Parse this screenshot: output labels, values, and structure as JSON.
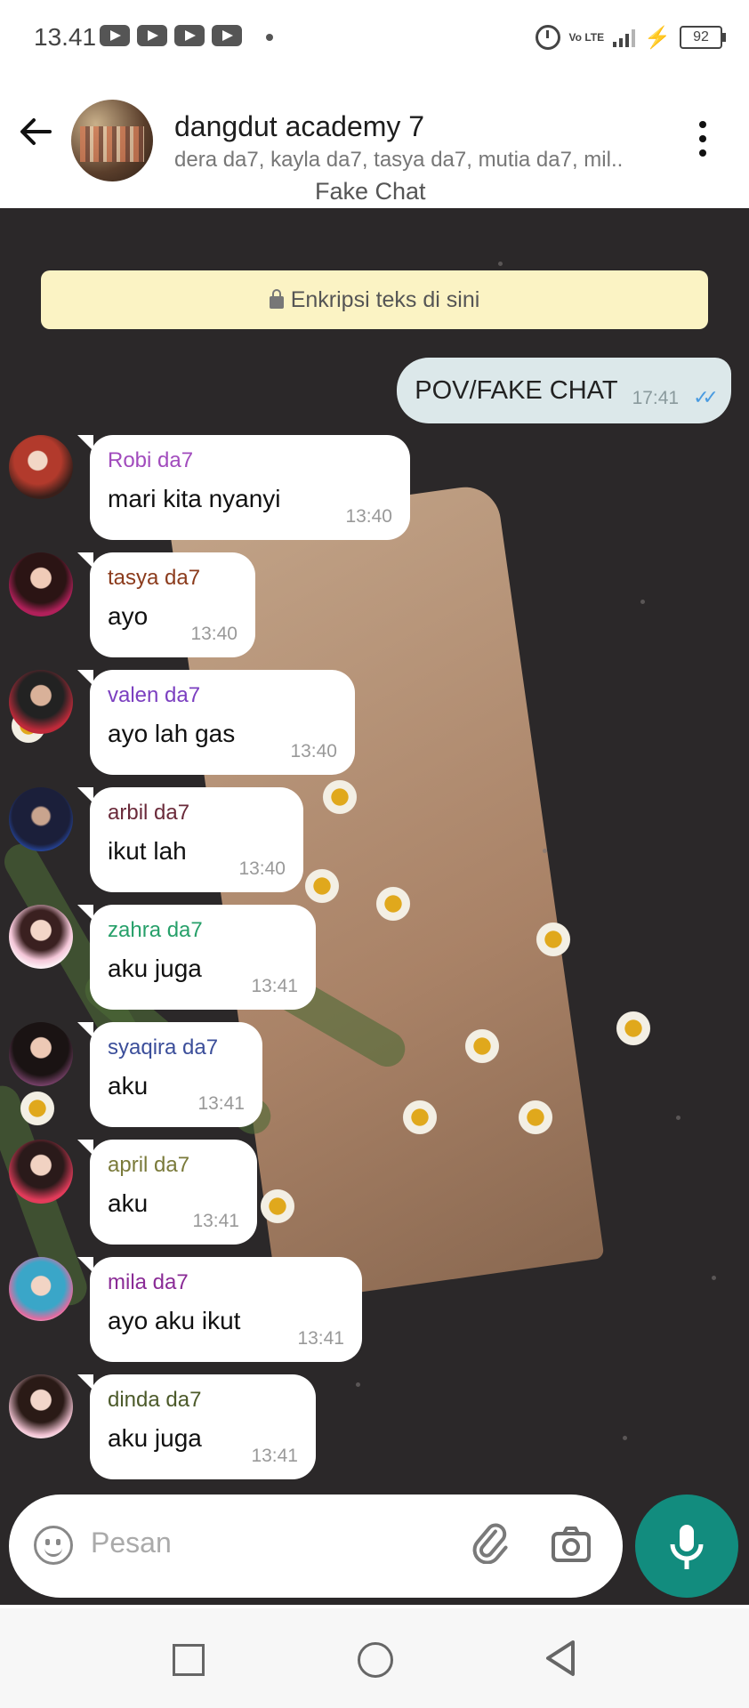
{
  "status_bar": {
    "time": "13.41",
    "volte": "Vo LTE",
    "battery": "92",
    "youtube_icons": 4
  },
  "header": {
    "title": "dangdut academy 7",
    "members": "dera da7, kayla da7, tasya da7, mutia da7, mil..",
    "subtitle": "Fake Chat"
  },
  "chat": {
    "encryption_notice": "Enkripsi teks di sini",
    "outgoing": {
      "text": "POV/FAKE CHAT",
      "time": "17:41"
    },
    "messages": [
      {
        "sender": "Robi da7",
        "text": "mari kita nyanyi",
        "time": "13:40",
        "color": "#a14bbd"
      },
      {
        "sender": "tasya da7",
        "text": "ayo",
        "time": "13:40",
        "color": "#8b3b1c"
      },
      {
        "sender": "valen da7",
        "text": "ayo lah gas",
        "time": "13:40",
        "color": "#7b3fc0"
      },
      {
        "sender": "arbil da7",
        "text": "ikut lah",
        "time": "13:40",
        "color": "#6a2a3a"
      },
      {
        "sender": "zahra da7",
        "text": "aku juga",
        "time": "13:41",
        "color": "#27a06a"
      },
      {
        "sender": "syaqira da7",
        "text": "aku",
        "time": "13:41",
        "color": "#3b4e9a"
      },
      {
        "sender": "april da7",
        "text": "aku",
        "time": "13:41",
        "color": "#7a7a3a"
      },
      {
        "sender": "mila da7",
        "text": "ayo aku ikut",
        "time": "13:41",
        "color": "#8a2b96"
      },
      {
        "sender": "dinda da7",
        "text": "aku juga",
        "time": "13:41",
        "color": "#4c5a2a"
      }
    ]
  },
  "input": {
    "placeholder": "Pesan"
  },
  "colors": {
    "accent": "#128c7e",
    "outgoing_bubble": "#dce8ea",
    "notice": "#fbf3c4",
    "read_ticks": "#4a9be0"
  }
}
